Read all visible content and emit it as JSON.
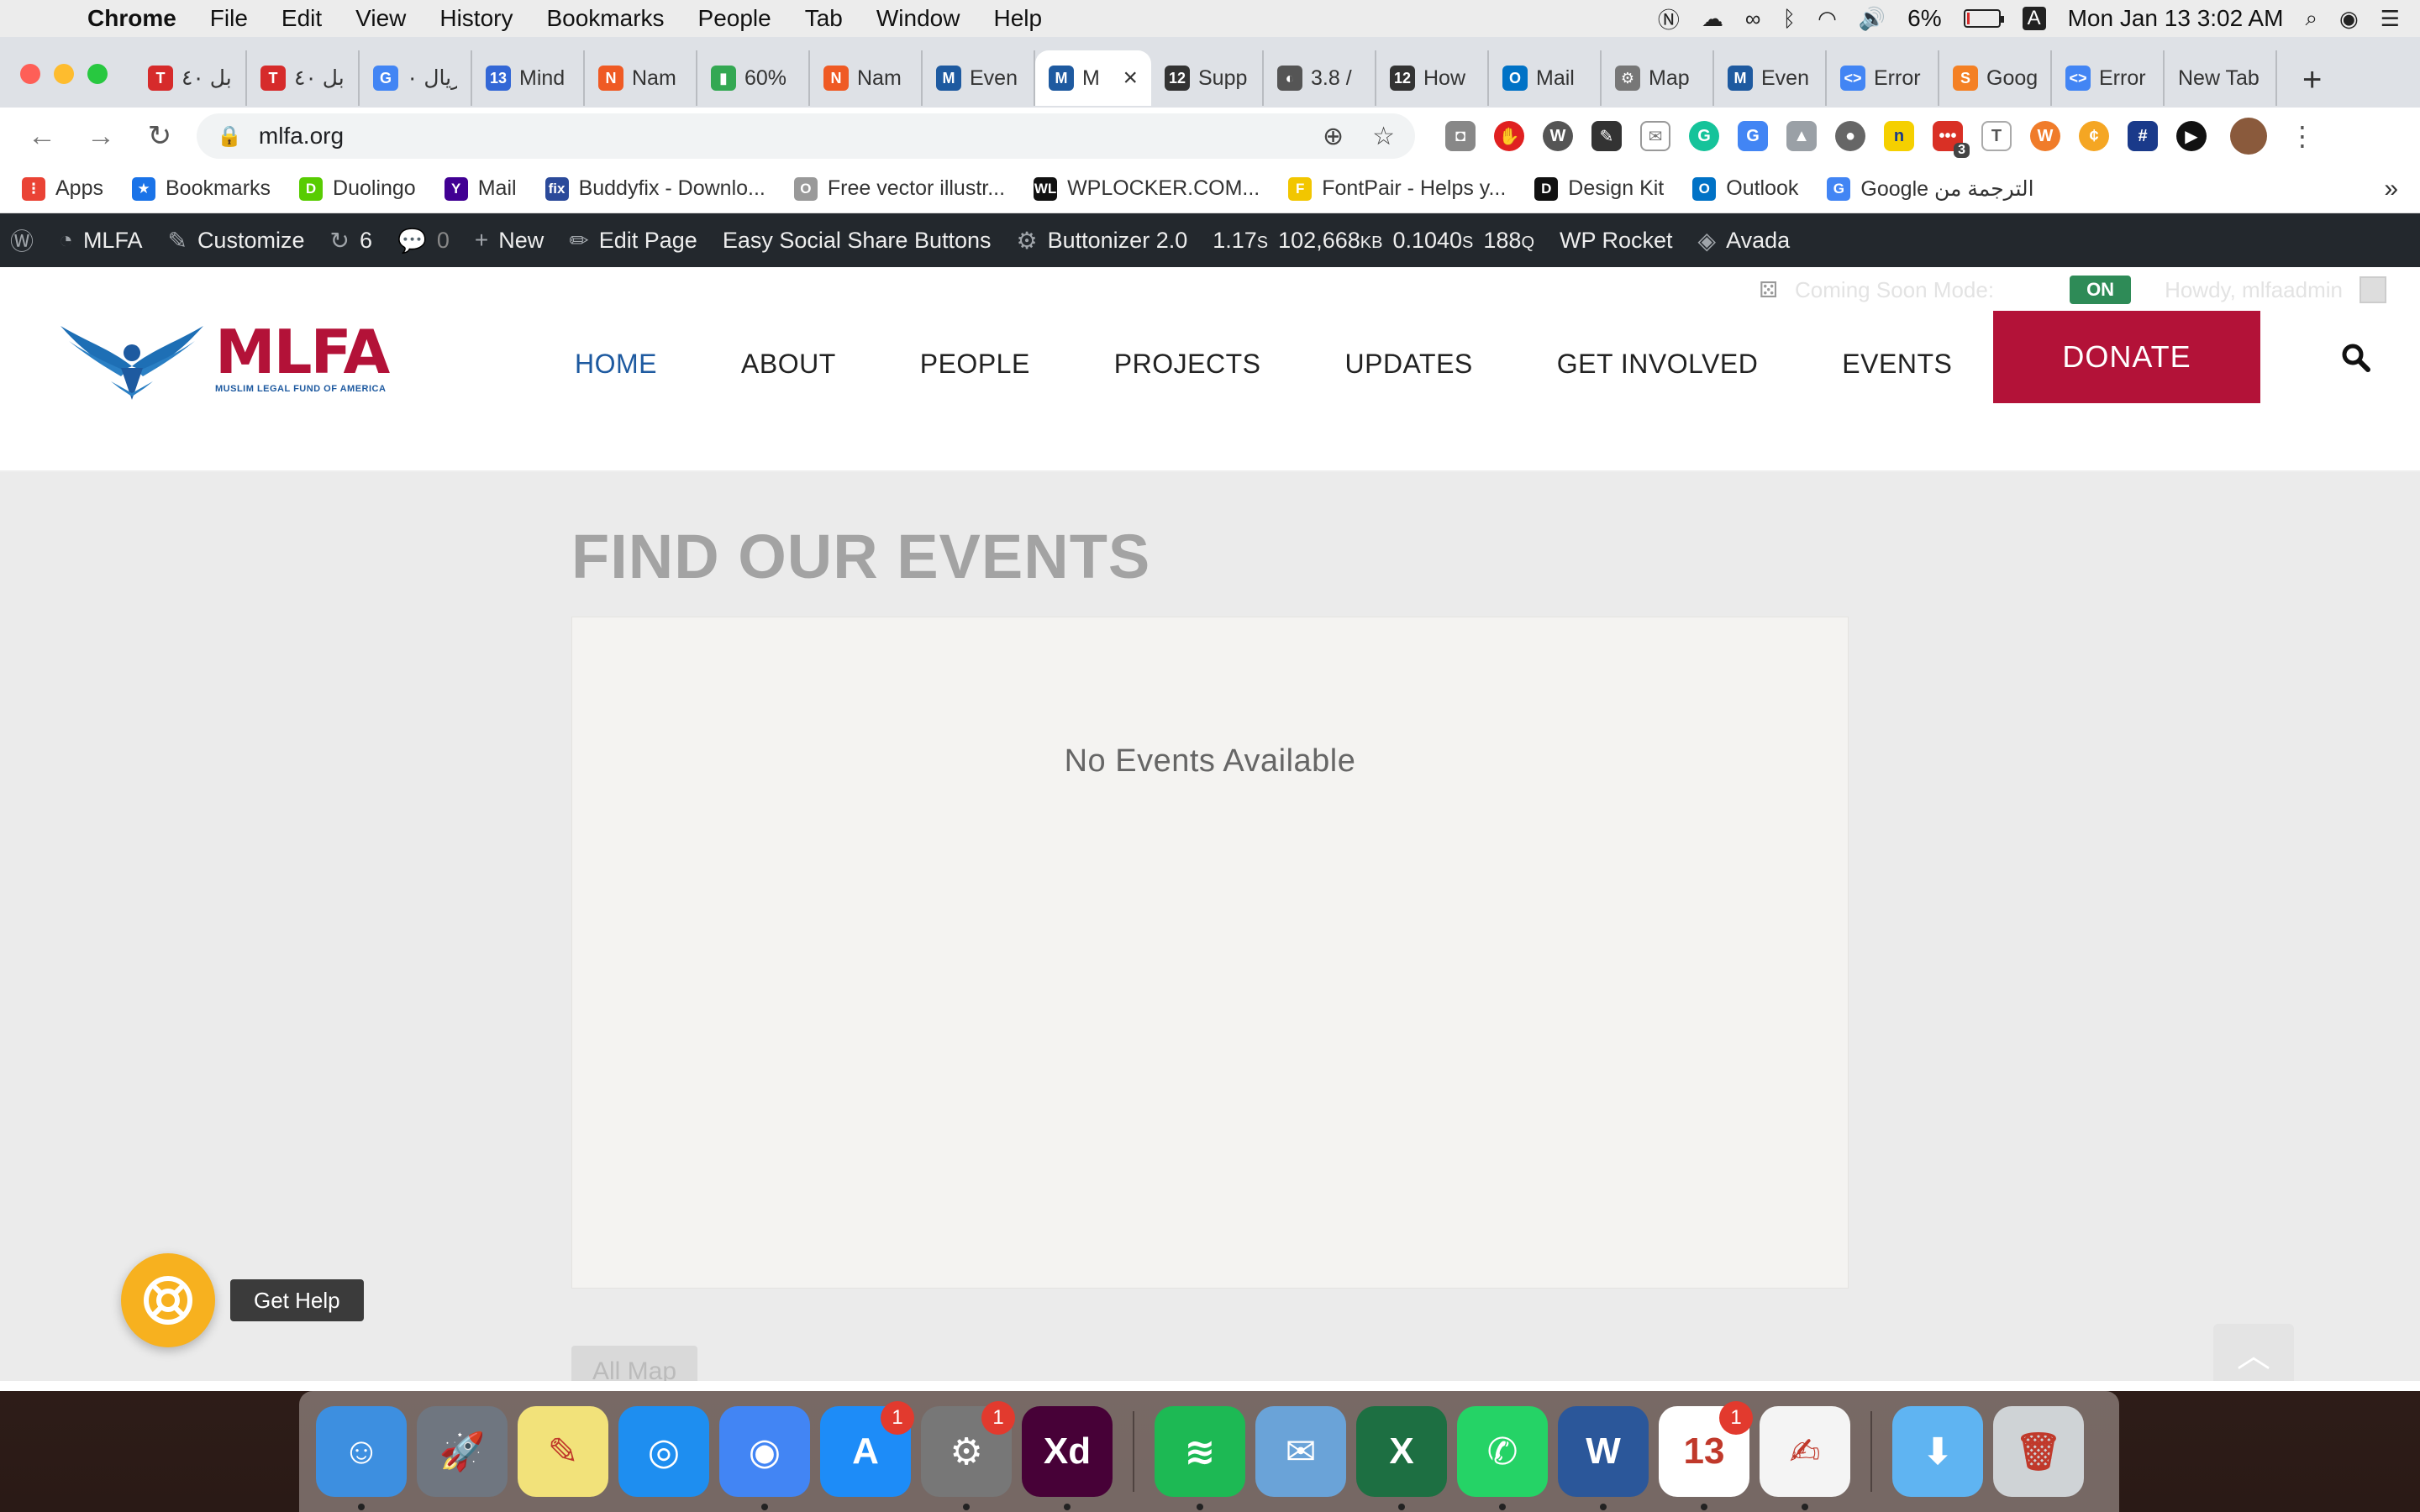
{
  "menubar": {
    "app": "Chrome",
    "items": [
      "File",
      "Edit",
      "View",
      "History",
      "Bookmarks",
      "People",
      "Tab",
      "Window",
      "Help"
    ],
    "battery_percent": "6%",
    "battery_level": 0.06,
    "input_source": "A",
    "clock": "Mon Jan 13  3:02 AM"
  },
  "tabs": [
    {
      "title": "ابل ٤٠",
      "color": "#d62b2b",
      "glyph": "T"
    },
    {
      "title": "ابل ٤٠",
      "color": "#d62b2b",
      "glyph": "T"
    },
    {
      "title": "ريال ٠",
      "color": "#4285f4",
      "glyph": "G"
    },
    {
      "title": "Mind",
      "color": "#3367d6",
      "glyph": "13"
    },
    {
      "title": "Nam",
      "color": "#ef5a24",
      "glyph": "N"
    },
    {
      "title": "60%",
      "color": "#34a853",
      "glyph": "▮"
    },
    {
      "title": "Nam",
      "color": "#ef5a24",
      "glyph": "N"
    },
    {
      "title": "Even",
      "color": "#1e5aa0",
      "glyph": "M"
    },
    {
      "title": "M",
      "color": "#1e5aa0",
      "glyph": "M",
      "active": true
    },
    {
      "title": "Supp",
      "color": "#333333",
      "glyph": "12"
    },
    {
      "title": "3.8 /",
      "color": "#555555",
      "glyph": "◐"
    },
    {
      "title": "How",
      "color": "#333333",
      "glyph": "12"
    },
    {
      "title": "Mail",
      "color": "#0072c6",
      "glyph": "O"
    },
    {
      "title": "Map",
      "color": "#777777",
      "glyph": "⚙"
    },
    {
      "title": "Even",
      "color": "#1e5aa0",
      "glyph": "M"
    },
    {
      "title": "Error",
      "color": "#4285f4",
      "glyph": "<>"
    },
    {
      "title": "Goog",
      "color": "#f48024",
      "glyph": "S"
    },
    {
      "title": "Error",
      "color": "#4285f4",
      "glyph": "<>"
    },
    {
      "title": "New Tab",
      "color": "",
      "glyph": ""
    }
  ],
  "toolbar": {
    "url": "mlfa.org",
    "extension_badge": "3"
  },
  "bookmarks": [
    {
      "label": "Apps",
      "color": "#ea4335",
      "glyph": "⋮"
    },
    {
      "label": "Bookmarks",
      "color": "#1a73e8",
      "glyph": "★"
    },
    {
      "label": "Duolingo",
      "color": "#58cc02",
      "glyph": "D"
    },
    {
      "label": "Mail",
      "color": "#410093",
      "glyph": "Y"
    },
    {
      "label": "Buddyfix - Downlo...",
      "color": "#2b4a9a",
      "glyph": "fix"
    },
    {
      "label": "Free vector illustr...",
      "color": "#999999",
      "glyph": "O"
    },
    {
      "label": "WPLOCKER.COM...",
      "color": "#111111",
      "glyph": "WL"
    },
    {
      "label": "FontPair - Helps y...",
      "color": "#f2c600",
      "glyph": "F"
    },
    {
      "label": "Design Kit",
      "color": "#111111",
      "glyph": "D"
    },
    {
      "label": "Outlook",
      "color": "#0072c6",
      "glyph": "O"
    },
    {
      "label": "Google الترجمة من",
      "color": "#4285f4",
      "glyph": "G"
    }
  ],
  "bookmarks_more": "»",
  "wpbar": {
    "site": "MLFA",
    "customize": "Customize",
    "updates": "6",
    "comments": "0",
    "new": "New",
    "edit_page": "Edit Page",
    "social": "Easy Social Share Buttons",
    "buttonizer": "Buttonizer 2.0",
    "stat_time": "1.17",
    "stat_time_unit": "S",
    "stat_mem": "102,668",
    "stat_mem_unit": "KB",
    "stat_db": "0.1040",
    "stat_db_unit": "S",
    "stat_q": "188",
    "stat_q_unit": "Q",
    "rocket": "WP Rocket",
    "avada": "Avada"
  },
  "site": {
    "coming_soon_label": "Coming Soon Mode:",
    "coming_soon_state": "ON",
    "howdy": "Howdy, mlfaadmin",
    "logo_text": "MLFA",
    "logo_sub": "MUSLIM LEGAL FUND OF AMERICA",
    "nav": [
      "HOME",
      "ABOUT",
      "PEOPLE",
      "PROJECTS",
      "UPDATES",
      "GET INVOLVED",
      "EVENTS"
    ],
    "donate": "DONATE",
    "events_title": "FIND OUR EVENTS",
    "no_events": "No Events Available",
    "all_map": "All Map",
    "help_label": "Get Help",
    "brand_red": "#b31238",
    "brand_blue": "#1e5aa0"
  },
  "dock": [
    {
      "name": "finder-icon",
      "color": "#3d8fe0",
      "glyph": "☺",
      "dot": true
    },
    {
      "name": "launchpad-icon",
      "color": "#6f7680",
      "glyph": "🚀",
      "dot": false
    },
    {
      "name": "stickies-icon",
      "color": "#f2e27a",
      "glyph": "✎",
      "dot": false
    },
    {
      "name": "safari-icon",
      "color": "#1e8ef0",
      "glyph": "◎",
      "dot": false
    },
    {
      "name": "chrome-icon",
      "color": "#4285f4",
      "glyph": "◉",
      "dot": true
    },
    {
      "name": "app-store-icon",
      "color": "#1d8cf8",
      "glyph": "A",
      "badge": "1",
      "dot": false
    },
    {
      "name": "system-preferences-icon",
      "color": "#777777",
      "glyph": "⚙",
      "badge": "1",
      "dot": true
    },
    {
      "name": "adobe-xd-icon",
      "color": "#470137",
      "glyph": "Xd",
      "dot": true
    },
    {
      "sep": true
    },
    {
      "name": "spotify-icon",
      "color": "#1db954",
      "glyph": "≋",
      "dot": true
    },
    {
      "name": "mail-icon",
      "color": "#6aa3d8",
      "glyph": "✉",
      "dot": false
    },
    {
      "name": "excel-icon",
      "color": "#1d6f42",
      "glyph": "X",
      "dot": true
    },
    {
      "name": "whatsapp-icon",
      "color": "#25d366",
      "glyph": "✆",
      "dot": true
    },
    {
      "name": "word-icon",
      "color": "#2b579a",
      "glyph": "W",
      "dot": true
    },
    {
      "name": "calendar-icon",
      "color": "#ffffff",
      "glyph": "13",
      "badge": "1",
      "dot": true
    },
    {
      "name": "textedit-icon",
      "color": "#f4f4f4",
      "glyph": "✍",
      "dot": true
    },
    {
      "sep": true
    },
    {
      "name": "downloads-folder-icon",
      "color": "#5fb4f2",
      "glyph": "⬇",
      "dot": false
    },
    {
      "name": "trash-icon",
      "color": "#cfd3d6",
      "glyph": "🗑",
      "dot": false
    }
  ]
}
